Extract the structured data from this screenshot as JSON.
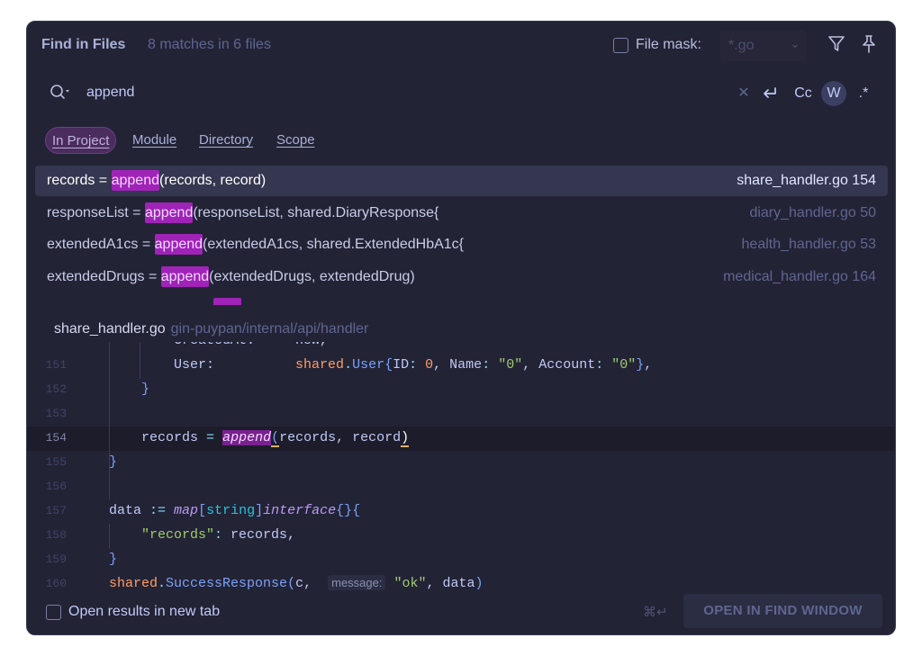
{
  "header": {
    "title": "Find in Files",
    "match_count": "8 matches in 6 files",
    "file_mask_label": "File mask:",
    "file_mask_value": "*.go"
  },
  "search": {
    "query": "append",
    "options": [
      "Cc",
      "W",
      ".*"
    ],
    "active_option": "W"
  },
  "scopes": {
    "in_project": "In Project",
    "module": "Module",
    "directory": "Directory",
    "scope": "Scope",
    "active": "In Project"
  },
  "results": [
    {
      "pre": "records = ",
      "match": "append",
      "post": "(records, record)",
      "file": "share_handler.go 154",
      "selected": true
    },
    {
      "pre": "responseList = ",
      "match": "append",
      "post": "(responseList, shared.DiaryResponse{",
      "file": "diary_handler.go 50",
      "selected": false
    },
    {
      "pre": "extendedA1cs = ",
      "match": "append",
      "post": "(extendedA1cs, shared.ExtendedHbA1c{",
      "file": "health_handler.go 53",
      "selected": false
    },
    {
      "pre": "extendedDrugs = ",
      "match": "append",
      "post": "(extendedDrugs, extendedDrug)",
      "file": "medical_handler.go 164",
      "selected": false
    }
  ],
  "preview": {
    "file_name": "share_handler.go",
    "file_path": "gin-puypan/internal/api/handler",
    "current_line": 154,
    "line_numbers": [
      "151",
      "152",
      "153",
      "154",
      "155",
      "156",
      "157",
      "158",
      "159",
      "160"
    ],
    "inlay_hint": "message:"
  },
  "footer": {
    "new_tab_label": "Open results in new tab",
    "shortcut": "⌘↵",
    "open_button": "OPEN IN FIND WINDOW"
  }
}
